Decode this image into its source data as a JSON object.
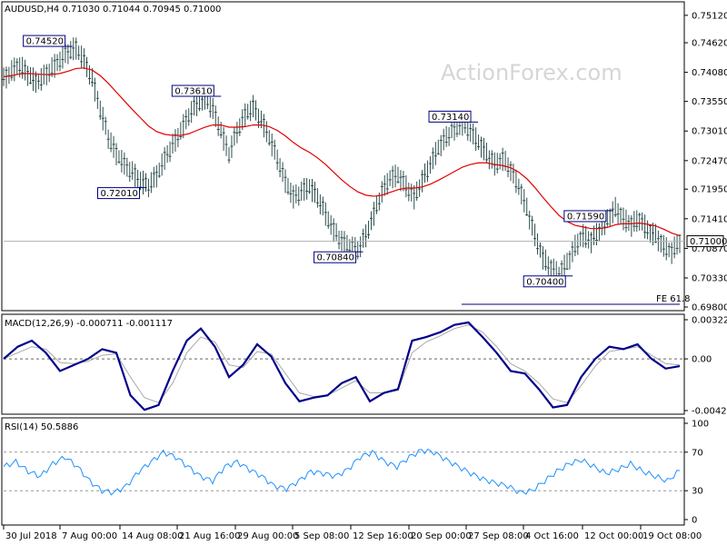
{
  "header": {
    "symbol_line": "AUDUSD,H4  0.71030 0.71044 0.70945 0.71000",
    "watermark": "ActionForex.com"
  },
  "colors": {
    "candle": "#2f4f4f",
    "ma": "#e00000",
    "macd_main": "#00008b",
    "macd_signal": "#a8a8a8",
    "rsi": "#1e90ff",
    "label_border": "#000080",
    "grid": "#000000"
  },
  "chart_data": [
    {
      "type": "candlestick",
      "title": "AUDUSD,H4  0.71030 0.71044 0.70945 0.71000",
      "y_ticks": [
        "0.75120",
        "0.74620",
        "0.74080",
        "0.73550",
        "0.73010",
        "0.72470",
        "0.71950",
        "0.71410",
        "0.70870",
        "0.70330",
        "0.69800"
      ],
      "ylim": [
        0.698,
        0.753
      ],
      "current_price": "0.71000",
      "moving_average": "red line",
      "annotations": [
        {
          "text": "0.74520",
          "value": 0.7452,
          "pos": 0.06
        },
        {
          "text": "0.72010",
          "value": 0.7201,
          "pos": 0.17
        },
        {
          "text": "0.73610",
          "value": 0.7361,
          "pos": 0.28
        },
        {
          "text": "0.70840",
          "value": 0.7084,
          "pos": 0.49
        },
        {
          "text": "0.73140",
          "value": 0.7314,
          "pos": 0.66
        },
        {
          "text": "0.70400",
          "value": 0.704,
          "pos": 0.8
        },
        {
          "text": "0.71590",
          "value": 0.7159,
          "pos": 0.86
        }
      ],
      "fib_label": "FE 61.8",
      "fib_level": 0.6985,
      "close_series": [
        0.7395,
        0.741,
        0.742,
        0.7405,
        0.739,
        0.74,
        0.7415,
        0.743,
        0.7445,
        0.7452,
        0.743,
        0.7395,
        0.734,
        0.729,
        0.726,
        0.724,
        0.7225,
        0.721,
        0.7201,
        0.722,
        0.725,
        0.7275,
        0.73,
        0.733,
        0.735,
        0.7361,
        0.734,
        0.73,
        0.726,
        0.73,
        0.733,
        0.7345,
        0.732,
        0.729,
        0.725,
        0.721,
        0.718,
        0.719,
        0.72,
        0.718,
        0.715,
        0.712,
        0.71,
        0.709,
        0.7084,
        0.711,
        0.715,
        0.719,
        0.7215,
        0.722,
        0.72,
        0.718,
        0.721,
        0.724,
        0.727,
        0.729,
        0.7305,
        0.7314,
        0.73,
        0.728,
        0.726,
        0.724,
        0.725,
        0.723,
        0.72,
        0.716,
        0.711,
        0.707,
        0.705,
        0.704,
        0.706,
        0.709,
        0.711,
        0.71,
        0.712,
        0.714,
        0.7159,
        0.714,
        0.713,
        0.714,
        0.712,
        0.711,
        0.709,
        0.708,
        0.71
      ],
      "ma_series": [
        0.74,
        0.7402,
        0.7405,
        0.7406,
        0.7405,
        0.7404,
        0.7404,
        0.7406,
        0.741,
        0.7415,
        0.7416,
        0.7412,
        0.7402,
        0.7388,
        0.7372,
        0.7356,
        0.734,
        0.7325,
        0.731,
        0.73,
        0.7295,
        0.7293,
        0.7293,
        0.7296,
        0.7302,
        0.7308,
        0.7312,
        0.7312,
        0.7308,
        0.7308,
        0.7309,
        0.7312,
        0.7312,
        0.7309,
        0.7302,
        0.7292,
        0.728,
        0.727,
        0.7262,
        0.7252,
        0.724,
        0.7226,
        0.7212,
        0.72,
        0.719,
        0.7184,
        0.7182,
        0.7184,
        0.7189,
        0.7194,
        0.7197,
        0.7197,
        0.7199,
        0.7204,
        0.7211,
        0.7219,
        0.7227,
        0.7235,
        0.724,
        0.7243,
        0.7243,
        0.724,
        0.7238,
        0.7234,
        0.7226,
        0.7214,
        0.7198,
        0.718,
        0.7163,
        0.7147,
        0.7136,
        0.7129,
        0.7126,
        0.7123,
        0.7123,
        0.7125,
        0.713,
        0.7132,
        0.7132,
        0.7133,
        0.7131,
        0.7128,
        0.7122,
        0.7115,
        0.711
      ]
    },
    {
      "type": "line",
      "title": "MACD(12,26,9) -0.000711 -0.001117",
      "y_ticks": [
        "0.003224",
        "0.00",
        "-0.004259"
      ],
      "ylim": [
        -0.004259,
        0.003224
      ],
      "series": [
        {
          "name": "MACD",
          "values": [
            0.0,
            0.001,
            0.0015,
            0.0005,
            -0.001,
            -0.0005,
            0.0,
            0.0008,
            0.0005,
            -0.003,
            -0.0042,
            -0.0038,
            -0.001,
            0.0015,
            0.0025,
            0.001,
            -0.0015,
            -0.0005,
            0.0012,
            0.0002,
            -0.002,
            -0.0035,
            -0.0032,
            -0.003,
            -0.002,
            -0.0015,
            -0.0035,
            -0.0028,
            -0.0025,
            0.0015,
            0.0018,
            0.0022,
            0.0028,
            0.003,
            0.0018,
            0.0005,
            -0.001,
            -0.0012,
            -0.0025,
            -0.004,
            -0.0038,
            -0.0015,
            0.0,
            0.001,
            0.0008,
            0.0012,
            0.0,
            -0.0008,
            -0.0006
          ]
        },
        {
          "name": "Signal",
          "values": [
            0.0,
            0.0005,
            0.001,
            0.0008,
            -0.0003,
            -0.0004,
            -0.0002,
            0.0003,
            0.0004,
            -0.0015,
            -0.0032,
            -0.0036,
            -0.002,
            0.0005,
            0.0018,
            0.0014,
            -0.0005,
            -0.0007,
            0.0006,
            0.0004,
            -0.0012,
            -0.0028,
            -0.0031,
            -0.003,
            -0.0024,
            -0.0018,
            -0.0028,
            -0.0028,
            -0.0026,
            0.0005,
            0.0014,
            0.0019,
            0.0025,
            0.0028,
            0.0022,
            0.001,
            -0.0004,
            -0.001,
            -0.002,
            -0.0033,
            -0.0036,
            -0.0022,
            -0.0006,
            0.0006,
            0.0008,
            0.001,
            0.0003,
            -0.0004,
            -0.0005
          ]
        }
      ]
    },
    {
      "type": "line",
      "title": "RSI(14) 50.5886",
      "y_ticks": [
        "100",
        "70",
        "30",
        "0"
      ],
      "ylim": [
        0,
        100
      ],
      "series": [
        {
          "name": "RSI",
          "values": [
            55,
            60,
            50,
            45,
            58,
            65,
            55,
            40,
            30,
            28,
            35,
            50,
            60,
            70,
            65,
            55,
            45,
            40,
            55,
            60,
            52,
            45,
            35,
            32,
            40,
            50,
            48,
            45,
            52,
            65,
            70,
            60,
            55,
            65,
            72,
            70,
            62,
            55,
            48,
            42,
            38,
            35,
            28,
            30,
            40,
            50,
            58,
            62,
            55,
            48,
            52,
            58,
            50,
            45,
            40,
            51
          ]
        }
      ]
    }
  ],
  "x_axis": {
    "labels": [
      "30 Jul 2018",
      "7 Aug 00:00",
      "14 Aug 08:00",
      "21 Aug 16:00",
      "29 Aug 00:00",
      "5 Sep 08:00",
      "12 Sep 16:00",
      "20 Sep 00:00",
      "27 Sep 08:00",
      "4 Oct 16:00",
      "12 Oct 00:00",
      "19 Oct 08:00"
    ]
  }
}
